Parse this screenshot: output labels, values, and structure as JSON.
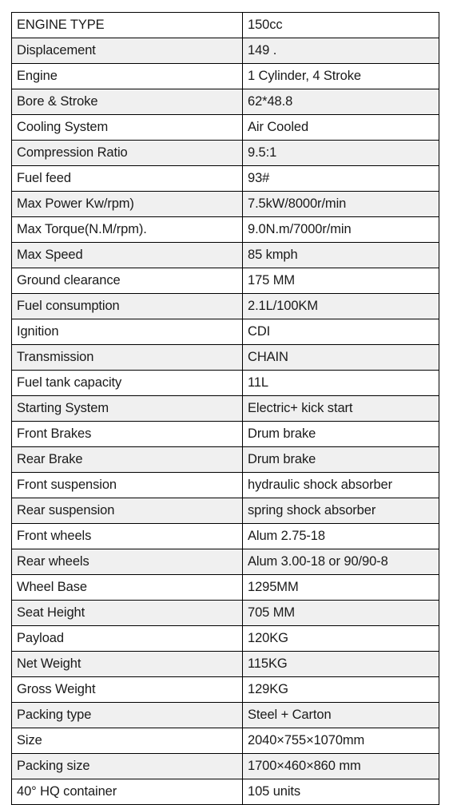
{
  "document": {
    "type": "specification-table",
    "title": "Motorcycle Specification Table",
    "columns": [
      "ENGINE TYPE",
      "150cc"
    ],
    "row_stripe_colors": {
      "odd": "#ffffff",
      "even": "#f0f0f0"
    },
    "border_color": "#000000",
    "text_color": "#1a1a1a"
  },
  "table": {
    "rows": [
      {
        "label": "ENGINE TYPE",
        "value": "150cc"
      },
      {
        "label": "Displacement",
        "value": "149 ."
      },
      {
        "label": "Engine",
        "value": "1 Cylinder, 4 Stroke"
      },
      {
        "label": "Bore & Stroke",
        "value": "62*48.8"
      },
      {
        "label": "Cooling System",
        "value": "Air Cooled"
      },
      {
        "label": "Compression Ratio",
        "value": "9.5:1"
      },
      {
        "label": "Fuel feed",
        "value": "93#"
      },
      {
        "label": "Max Power Kw/rpm)",
        "value": "7.5kW/8000r/min"
      },
      {
        "label": "Max Torque(N.M/rpm).",
        "value": "9.0N.m/7000r/min"
      },
      {
        "label": "Max Speed",
        "value": "85 kmph"
      },
      {
        "label": "Ground clearance",
        "value": "175 MM"
      },
      {
        "label": "Fuel consumption",
        "value": "2.1L/100KM"
      },
      {
        "label": "Ignition",
        "value": "CDI"
      },
      {
        "label": "Transmission",
        "value": "CHAIN"
      },
      {
        "label": "Fuel tank capacity",
        "value": "11L"
      },
      {
        "label": "Starting System",
        "value": "Electric+ kick start"
      },
      {
        "label": "Front Brakes",
        "value": "Drum brake"
      },
      {
        "label": "Rear Brake",
        "value": "Drum brake"
      },
      {
        "label": "Front suspension",
        "value": "hydraulic shock absorber"
      },
      {
        "label": "Rear suspension",
        "value": "spring shock absorber"
      },
      {
        "label": "Front wheels",
        "value": "Alum 2.75-18"
      },
      {
        "label": "Rear wheels",
        "value": "Alum 3.00-18 or 90/90-8"
      },
      {
        "label": "Wheel Base",
        "value": "1295MM"
      },
      {
        "label": "Seat Height",
        "value": "705 MM"
      },
      {
        "label": "Payload",
        "value": "120KG"
      },
      {
        "label": "Net Weight",
        "value": "115KG"
      },
      {
        "label": "Gross Weight",
        "value": "129KG"
      },
      {
        "label": "Packing type",
        "value": "Steel + Carton"
      },
      {
        "label": "Size",
        "value": "2040×755×1070mm"
      },
      {
        "label": "Packing size",
        "value": "1700×460×860 mm"
      },
      {
        "label": "40° HQ container",
        "value": "105 units"
      }
    ]
  }
}
